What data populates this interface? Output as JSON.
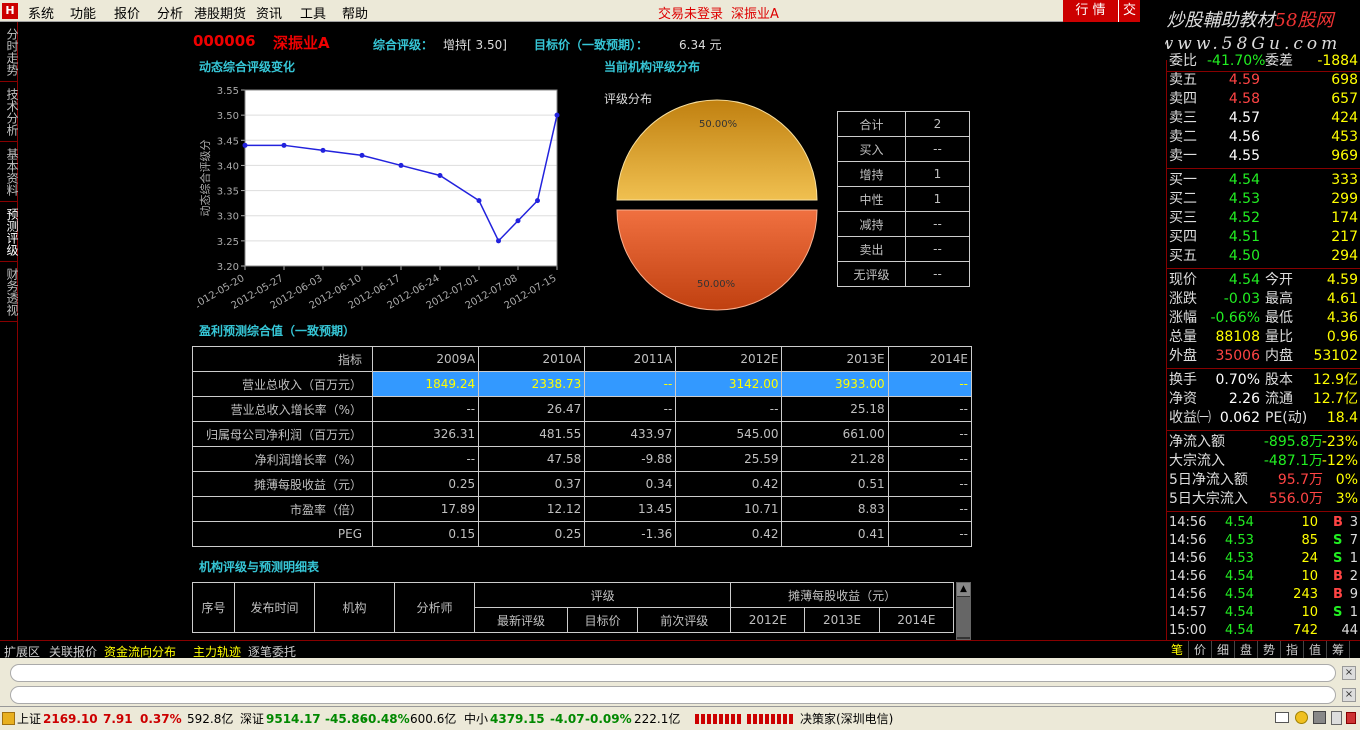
{
  "menu": {
    "items": [
      "系统",
      "功能",
      "报价",
      "分析",
      "港股期货",
      "资讯",
      "工具",
      "帮助"
    ],
    "trade_status": "交易未登录",
    "trade_stock": "深振业A",
    "hq_label": "行 情",
    "hq2_label": "交"
  },
  "watermark": {
    "line1a": "炒股輔助教材",
    "line1b": "58股网",
    "line2": "www.58Gu.com"
  },
  "left_tabs": [
    "分时走势",
    "技术分析",
    "基本资料",
    "预测评级",
    "财务透视"
  ],
  "header": {
    "code": "000006",
    "name": "深振业A",
    "rating_label": "综合评级：",
    "rating_value": "增持[ 3.50]",
    "target_label": "目标价（一致预期）：",
    "target_value": "6.34 元"
  },
  "sections": {
    "trend": "动态综合评级变化",
    "dist": "当前机构评级分布",
    "forecast": "盈利预测综合值（一致预期）",
    "detail": "机构评级与预测明细表"
  },
  "chart_data": {
    "type": "line",
    "ylabel": "动态综合评级分",
    "ylim": [
      3.2,
      3.55
    ],
    "yticks": [
      "3.20",
      "3.25",
      "3.30",
      "3.35",
      "3.40",
      "3.45",
      "3.50",
      "3.55"
    ],
    "categories": [
      "2012-05-20",
      "2012-05-27",
      "2012-06-03",
      "2012-06-10",
      "2012-06-17",
      "2012-06-24",
      "2012-07-01",
      "2012-07-08",
      "2012-07-15"
    ],
    "x": [
      0,
      1,
      2,
      3,
      4,
      5,
      6,
      6.5,
      7,
      7.5,
      8
    ],
    "values": [
      3.44,
      3.44,
      3.43,
      3.42,
      3.4,
      3.38,
      3.33,
      3.25,
      3.29,
      3.33,
      3.5
    ],
    "color": "#2222dd"
  },
  "pie": {
    "title": "评级分布",
    "top_pct": "50.00%",
    "bottom_pct": "50.00%",
    "top_color": "#d8a020",
    "bottom_color": "#e06030"
  },
  "rating_table": [
    [
      "合计",
      "2"
    ],
    [
      "买入",
      "--"
    ],
    [
      "增持",
      "1"
    ],
    [
      "中性",
      "1"
    ],
    [
      "减持",
      "--"
    ],
    [
      "卖出",
      "--"
    ],
    [
      "无评级",
      "--"
    ]
  ],
  "forecast": {
    "headers": [
      "指标",
      "2009A",
      "2010A",
      "2011A",
      "2012E",
      "2013E",
      "2014E"
    ],
    "rows": [
      [
        "营业总收入（百万元）",
        "1849.24",
        "2338.73",
        "--",
        "3142.00",
        "3933.00",
        "--"
      ],
      [
        "营业总收入增长率（%）",
        "--",
        "26.47",
        "--",
        "--",
        "25.18",
        "--"
      ],
      [
        "归属母公司净利润（百万元）",
        "326.31",
        "481.55",
        "433.97",
        "545.00",
        "661.00",
        "--"
      ],
      [
        "净利润增长率（%）",
        "--",
        "47.58",
        "-9.88",
        "25.59",
        "21.28",
        "--"
      ],
      [
        "摊薄每股收益（元）",
        "0.25",
        "0.37",
        "0.34",
        "0.42",
        "0.51",
        "--"
      ],
      [
        "市盈率（倍）",
        "17.89",
        "12.12",
        "13.45",
        "10.71",
        "8.83",
        "--"
      ],
      [
        "PEG",
        "0.15",
        "0.25",
        "-1.36",
        "0.42",
        "0.41",
        "--"
      ]
    ]
  },
  "detail": {
    "h1": [
      "序号",
      "发布时间",
      "机构",
      "分析师",
      "评级",
      "摊薄每股收益（元）"
    ],
    "h2": [
      "最新评级",
      "目标价",
      "前次评级",
      "2012E",
      "2013E",
      "2014E"
    ]
  },
  "right": {
    "weibi": {
      "l": "委比",
      "p": "-41.70%",
      "l2": "委差",
      "v": "-1884"
    },
    "sells": [
      [
        "卖五",
        "4.59",
        "698"
      ],
      [
        "卖四",
        "4.58",
        "657"
      ],
      [
        "卖三",
        "4.57",
        "424"
      ],
      [
        "卖二",
        "4.56",
        "453"
      ],
      [
        "卖一",
        "4.55",
        "969"
      ]
    ],
    "buys": [
      [
        "买一",
        "4.54",
        "333"
      ],
      [
        "买二",
        "4.53",
        "299"
      ],
      [
        "买三",
        "4.52",
        "174"
      ],
      [
        "买四",
        "4.51",
        "217"
      ],
      [
        "买五",
        "4.50",
        "294"
      ]
    ],
    "quote": [
      [
        "现价",
        "4.54",
        "今开",
        "4.59"
      ],
      [
        "涨跌",
        "-0.03",
        "最高",
        "4.61"
      ],
      [
        "涨幅",
        "-0.66%",
        "最低",
        "4.36"
      ],
      [
        "总量",
        "88108",
        "量比",
        "0.96"
      ],
      [
        "外盘",
        "35006",
        "内盘",
        "53102"
      ]
    ],
    "stats": [
      [
        "换手",
        "0.70%",
        "股本",
        "12.9亿"
      ],
      [
        "净资",
        "2.26",
        "流通",
        "12.7亿"
      ],
      [
        "收益㈠",
        "0.062",
        "PE(动)",
        "18.4"
      ]
    ],
    "flows": [
      [
        "净流入额",
        "-895.8万",
        "-23%"
      ],
      [
        "大宗流入",
        "-487.1万",
        "-12%"
      ],
      [
        "5日净流入额",
        "95.7万",
        "0%"
      ],
      [
        "5日大宗流入",
        "556.0万",
        "3%"
      ]
    ],
    "ticks": [
      [
        "14:56",
        "4.54",
        "10",
        "B",
        "3"
      ],
      [
        "14:56",
        "4.53",
        "85",
        "S",
        "7"
      ],
      [
        "14:56",
        "4.53",
        "24",
        "S",
        "1"
      ],
      [
        "14:56",
        "4.54",
        "10",
        "B",
        "2"
      ],
      [
        "14:56",
        "4.54",
        "243",
        "B",
        "9"
      ],
      [
        "14:57",
        "4.54",
        "10",
        "S",
        "1"
      ],
      [
        "15:00",
        "4.54",
        "742",
        "",
        "44"
      ]
    ],
    "bottom_tabs": [
      "笔",
      "价",
      "细",
      "盘",
      "势",
      "指",
      "值",
      "筹"
    ]
  },
  "bottom_tabs": [
    "扩展区",
    "关联报价",
    "资金流向分布",
    "主力轨迹",
    "逐笔委托"
  ],
  "status": {
    "sh_label": "上证",
    "sh": "2169.10",
    "sh_chg": "7.91",
    "sh_pct": "0.37%",
    "sh_amt": "592.8亿",
    "sz_label": "深证",
    "sz": "9514.17",
    "sz_chg": "-45.86",
    "sz_pct": "-0.48%",
    "sz_amt": "600.6亿",
    "zx_label": "中小",
    "zx": "4379.15",
    "zx_chg": "-4.07",
    "zx_pct": "-0.09%",
    "zx_amt": "222.1亿",
    "server": "决策家(深圳电信)"
  }
}
